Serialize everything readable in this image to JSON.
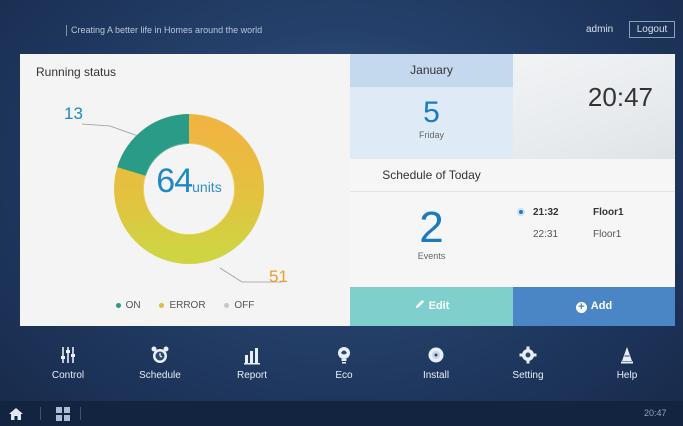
{
  "header": {
    "tagline": "Creating A better life in Homes around the world",
    "user": "admin",
    "logout_label": "Logout"
  },
  "running_status": {
    "title": "Running status",
    "total": "64",
    "unit": "units",
    "on_count": "13",
    "error_count": "51",
    "on_fraction": 0.203,
    "legend": {
      "on": "ON",
      "error": "ERROR",
      "off": "OFF"
    },
    "colors": {
      "on": "#2a9b86",
      "error": "#e8b443",
      "off": "#c8d34a"
    }
  },
  "calendar": {
    "month": "January",
    "day": "5",
    "weekday": "Friday",
    "time": "20:47"
  },
  "schedule": {
    "title": "Schedule of Today",
    "count": "2",
    "count_label": "Events",
    "events": [
      {
        "time": "21:32",
        "location": "Floor1"
      },
      {
        "time": "22:31",
        "location": "Floor1"
      }
    ],
    "edit_label": "Edit",
    "add_label": "Add"
  },
  "nav": {
    "items": [
      {
        "label": "Control"
      },
      {
        "label": "Schedule"
      },
      {
        "label": "Report"
      },
      {
        "label": "Eco"
      },
      {
        "label": "Install"
      },
      {
        "label": "Setting"
      },
      {
        "label": "Help"
      }
    ]
  },
  "footer": {
    "time": "20:47"
  }
}
